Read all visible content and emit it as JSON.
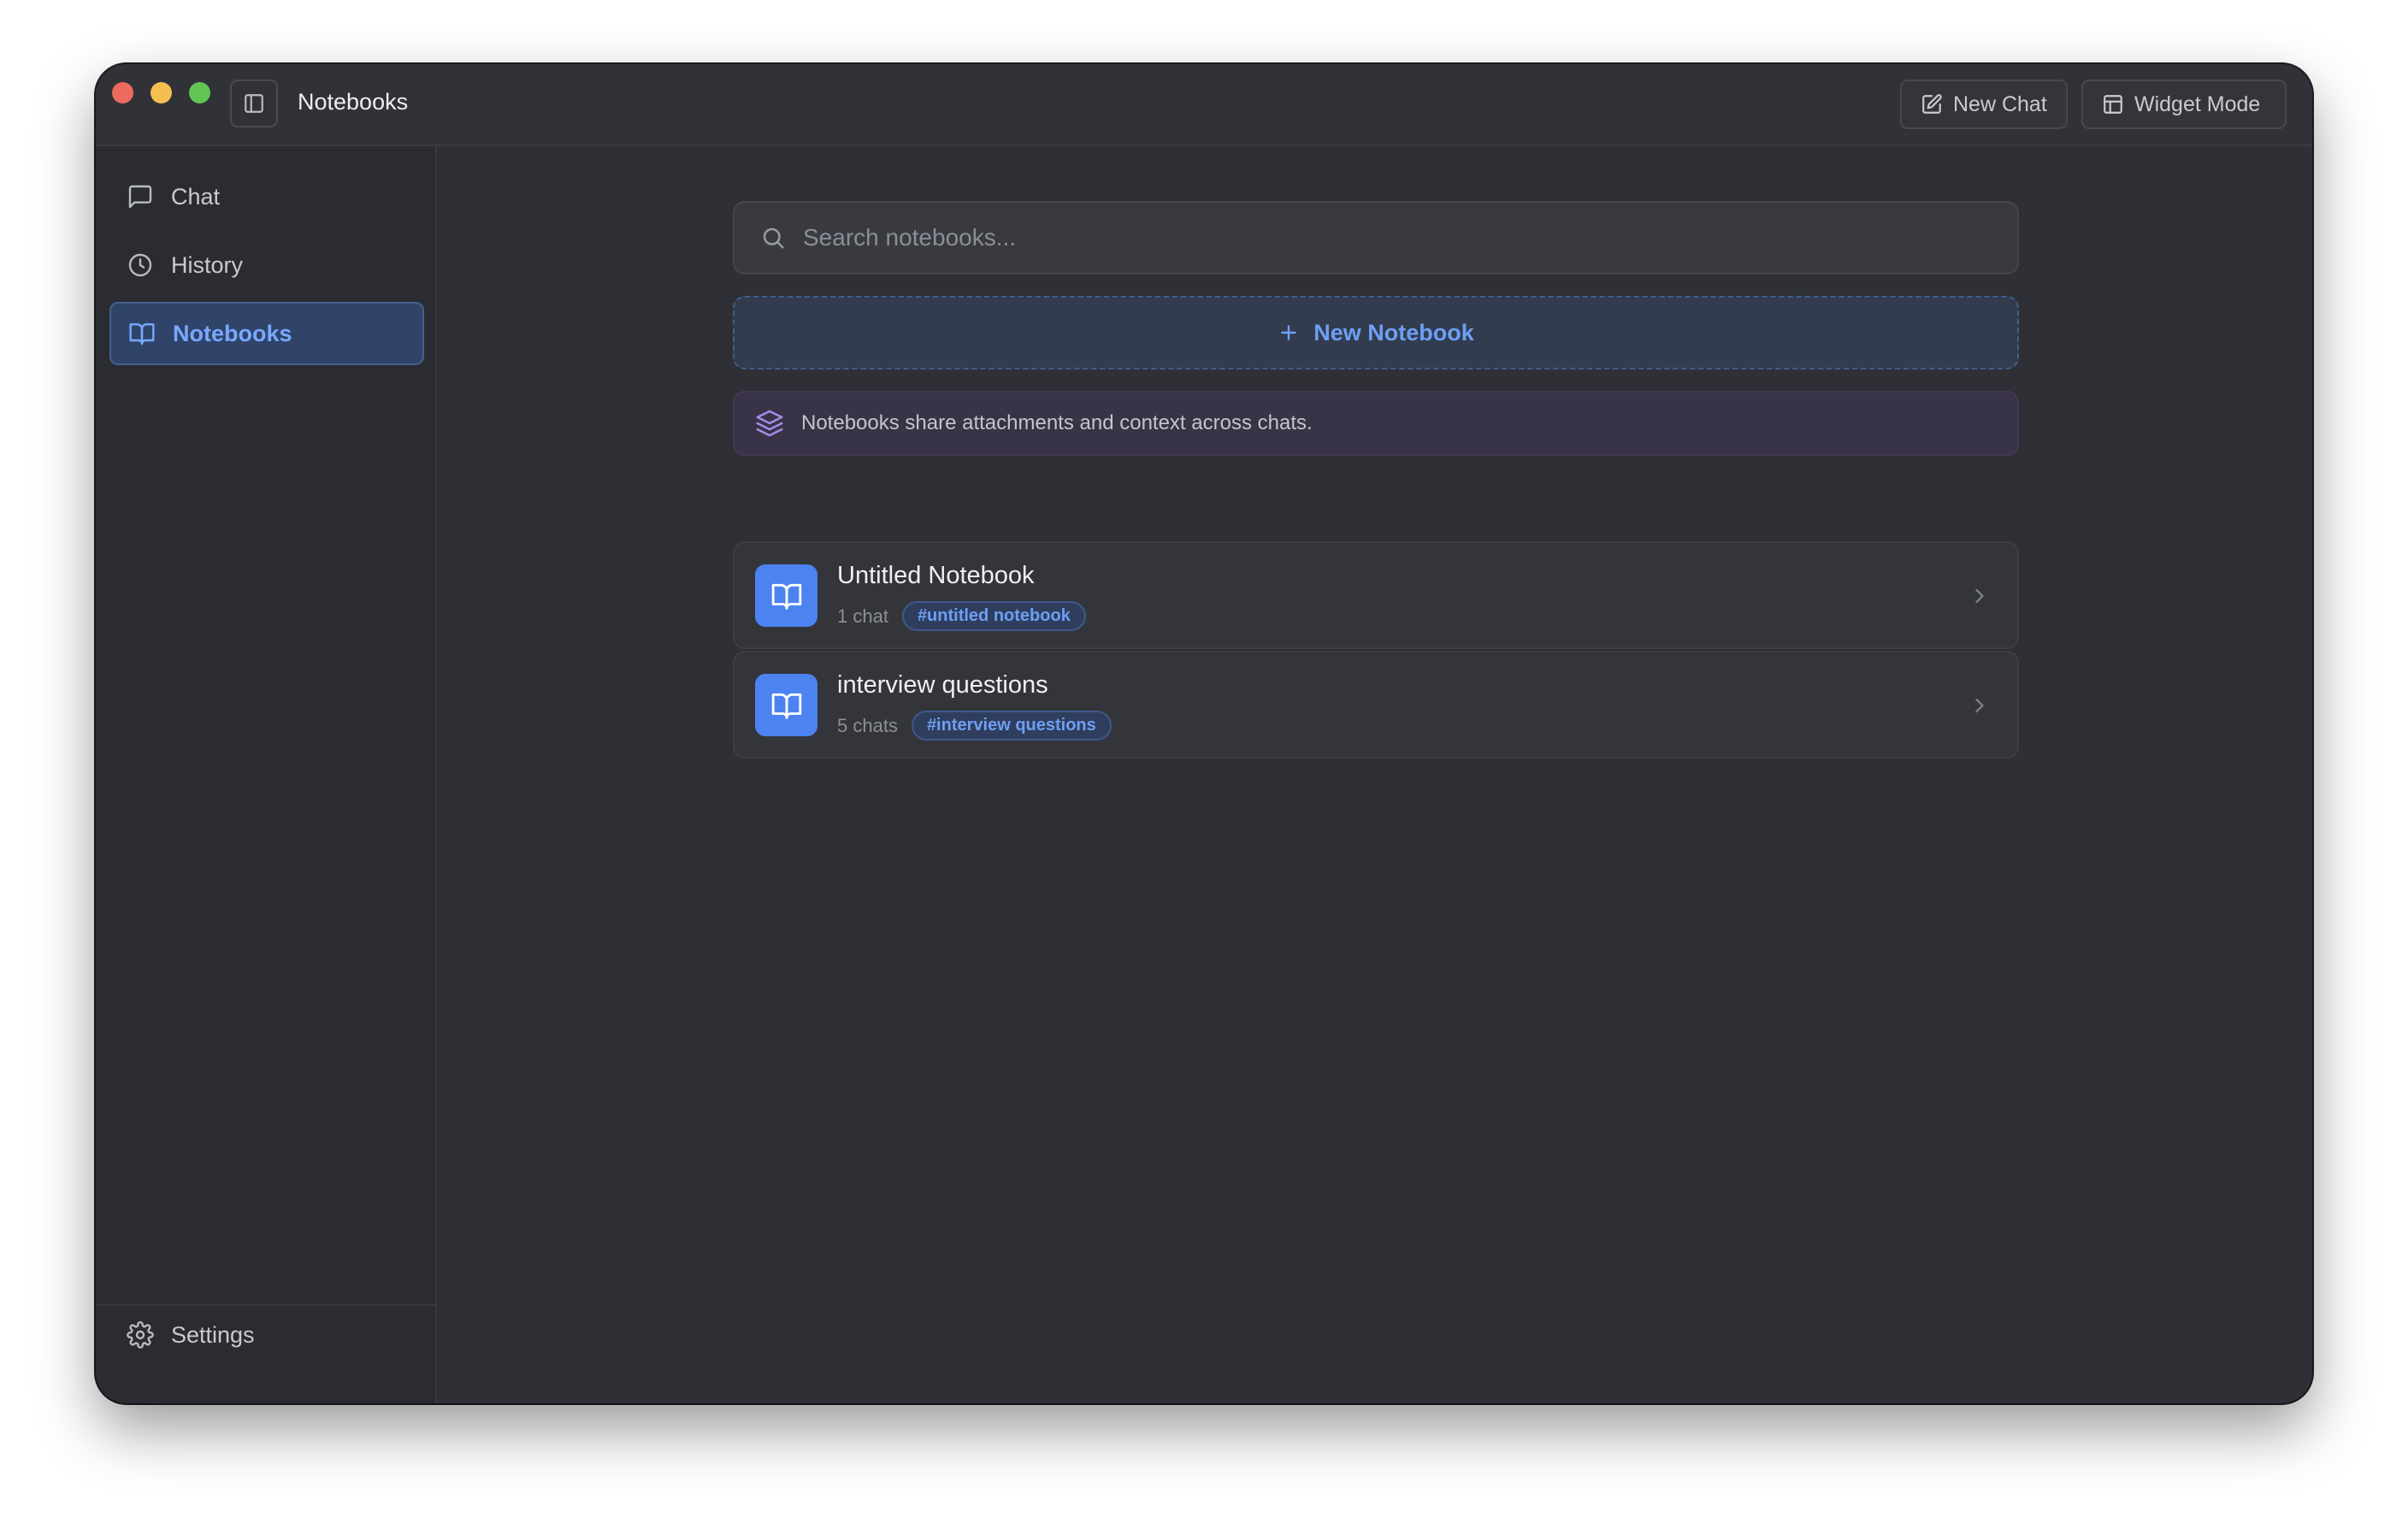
{
  "window": {
    "title": "Notebooks"
  },
  "toolbar": {
    "new_chat_label": "New Chat",
    "widget_mode_label": "Widget Mode"
  },
  "sidebar": {
    "items": [
      {
        "label": "Chat",
        "icon": "chat-bubble-icon",
        "active": false
      },
      {
        "label": "History",
        "icon": "clock-icon",
        "active": false
      },
      {
        "label": "Notebooks",
        "icon": "book-open-icon",
        "active": true
      }
    ],
    "settings_label": "Settings"
  },
  "main": {
    "search": {
      "placeholder": "Search notebooks...",
      "value": ""
    },
    "new_notebook_label": "New Notebook",
    "info_text": "Notebooks share attachments and context across chats.",
    "notebooks": [
      {
        "title": "Untitled Notebook",
        "count": "1 chat",
        "tag": "#untitled notebook"
      },
      {
        "title": "interview questions",
        "count": "5 chats",
        "tag": "#interview questions"
      }
    ]
  },
  "colors": {
    "accent": "#4c83f0",
    "accent_text": "#6e9ff5",
    "window_bg": "#2f3036",
    "sidebar_bg": "#2b2c31",
    "traffic_close": "#ed6a5e",
    "traffic_minimize": "#f4bf4f",
    "traffic_maximize": "#61c554"
  }
}
